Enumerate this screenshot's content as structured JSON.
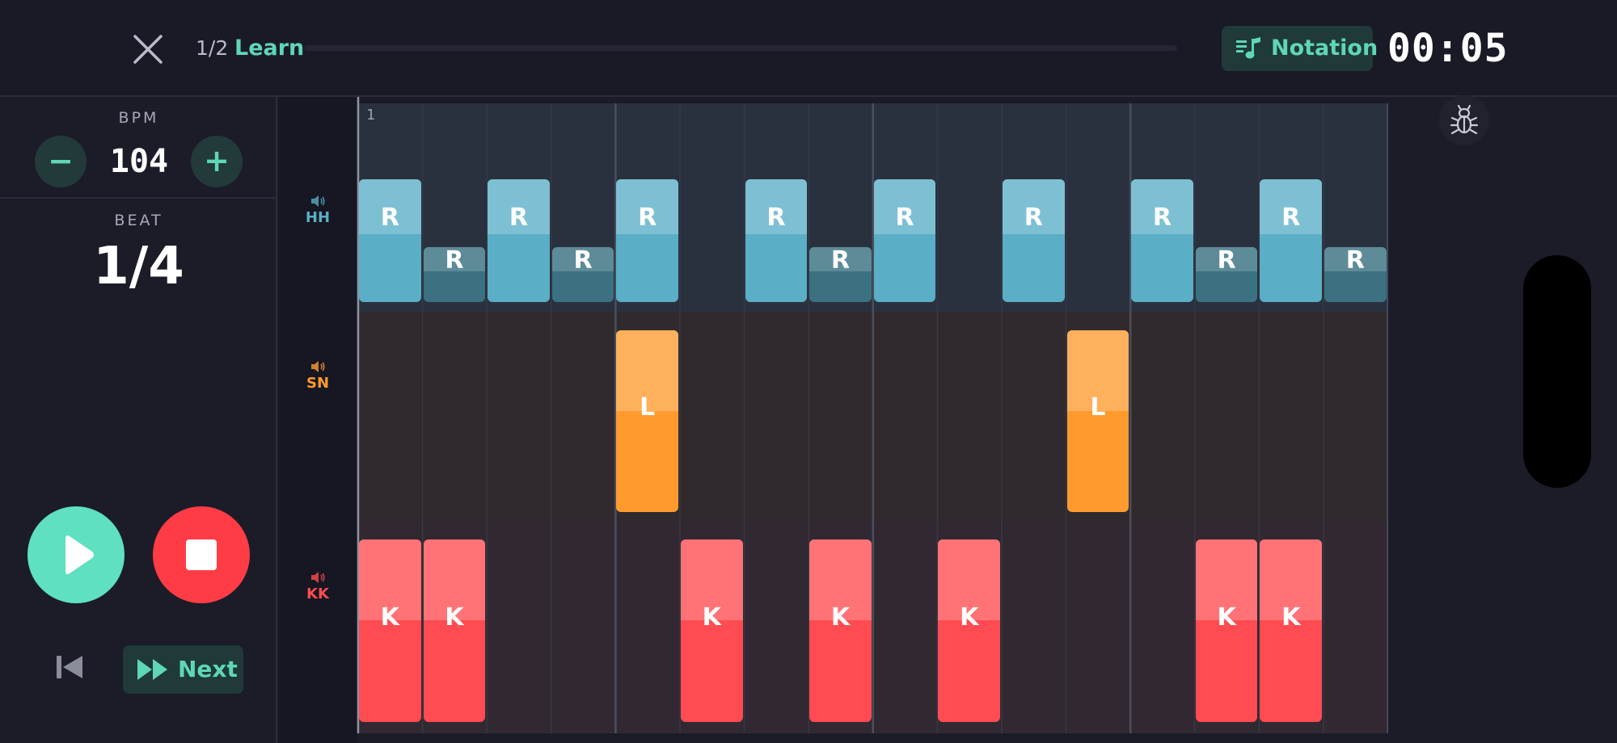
{
  "header": {
    "progress_counter": "1/2",
    "progress_label": "Learn",
    "notation_label": "Notation",
    "timer": "00:05"
  },
  "controls": {
    "bpm_caption": "BPM",
    "bpm_value": "104",
    "minus_symbol": "−",
    "plus_symbol": "+",
    "beat_caption": "BEAT",
    "beat_value": "1/4",
    "next_label": "Next"
  },
  "grid": {
    "bar_number": "1",
    "steps": 16,
    "tracks": [
      {
        "id": "hh",
        "name": "HH",
        "color": "#5aaec6",
        "notes": [
          {
            "step": 0,
            "label": "R",
            "accent": true
          },
          {
            "step": 1,
            "label": "R",
            "accent": false
          },
          {
            "step": 2,
            "label": "R",
            "accent": true
          },
          {
            "step": 3,
            "label": "R",
            "accent": false
          },
          {
            "step": 4,
            "label": "R",
            "accent": true
          },
          {
            "step": 6,
            "label": "R",
            "accent": true
          },
          {
            "step": 7,
            "label": "R",
            "accent": false
          },
          {
            "step": 8,
            "label": "R",
            "accent": true
          },
          {
            "step": 10,
            "label": "R",
            "accent": true
          },
          {
            "step": 12,
            "label": "R",
            "accent": true
          },
          {
            "step": 13,
            "label": "R",
            "accent": false
          },
          {
            "step": 14,
            "label": "R",
            "accent": true
          },
          {
            "step": 15,
            "label": "R",
            "accent": false
          }
        ]
      },
      {
        "id": "sn",
        "name": "SN",
        "color": "#ff9a2e",
        "notes": [
          {
            "step": 4,
            "label": "L",
            "accent": true
          },
          {
            "step": 11,
            "label": "L",
            "accent": true
          }
        ]
      },
      {
        "id": "kk",
        "name": "KK",
        "color": "#ff4b51",
        "notes": [
          {
            "step": 0,
            "label": "K",
            "accent": true
          },
          {
            "step": 1,
            "label": "K",
            "accent": true
          },
          {
            "step": 5,
            "label": "K",
            "accent": true
          },
          {
            "step": 7,
            "label": "K",
            "accent": true
          },
          {
            "step": 9,
            "label": "K",
            "accent": true
          },
          {
            "step": 13,
            "label": "K",
            "accent": true
          },
          {
            "step": 14,
            "label": "K",
            "accent": true
          }
        ]
      }
    ]
  },
  "icons": {
    "close": "close-icon",
    "notation": "music-note-list-icon",
    "speaker": "speaker-icon",
    "play": "play-icon",
    "stop": "stop-icon",
    "previous": "skip-back-icon",
    "next": "fast-forward-icon",
    "debug": "bug-icon"
  }
}
